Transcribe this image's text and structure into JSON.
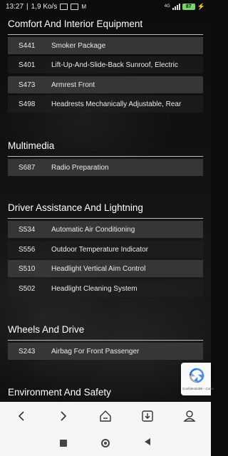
{
  "status_bar": {
    "time": "13:27",
    "speed": "1,9 Ko/s",
    "network": "4G",
    "battery": "87"
  },
  "sections": [
    {
      "title": "Comfort And Interior Equipment",
      "items": [
        {
          "code": "S441",
          "description": "Smoker Package"
        },
        {
          "code": "S401",
          "description": "Lift-Up-And-Slide-Back Sunroof, Electric"
        },
        {
          "code": "S473",
          "description": "Armrest Front"
        },
        {
          "code": "S498",
          "description": "Headrests Mechanically Adjustable, Rear"
        }
      ]
    },
    {
      "title": "Multimedia",
      "items": [
        {
          "code": "S687",
          "description": "Radio Preparation"
        }
      ]
    },
    {
      "title": "Driver Assistance And Lightning",
      "items": [
        {
          "code": "S534",
          "description": "Automatic Air Conditioning"
        },
        {
          "code": "S556",
          "description": "Outdoor Temperature Indicator"
        },
        {
          "code": "S510",
          "description": "Headlight Vertical Aim Control"
        },
        {
          "code": "S502",
          "description": "Headlight Cleaning System"
        }
      ]
    },
    {
      "title": "Wheels And Drive",
      "items": [
        {
          "code": "S243",
          "description": "Airbag For Front Passenger"
        }
      ]
    },
    {
      "title": "Environment And Safety",
      "items": []
    }
  ],
  "recaptcha": {
    "text": "Confidentialité - Condi"
  },
  "browser_toolbar": {
    "icons": [
      "back-icon",
      "forward-icon",
      "home-icon",
      "download-icon",
      "profile-icon"
    ]
  },
  "system_nav": {
    "icons": [
      "recents-icon",
      "home-circle-icon",
      "back-triangle-icon"
    ]
  }
}
